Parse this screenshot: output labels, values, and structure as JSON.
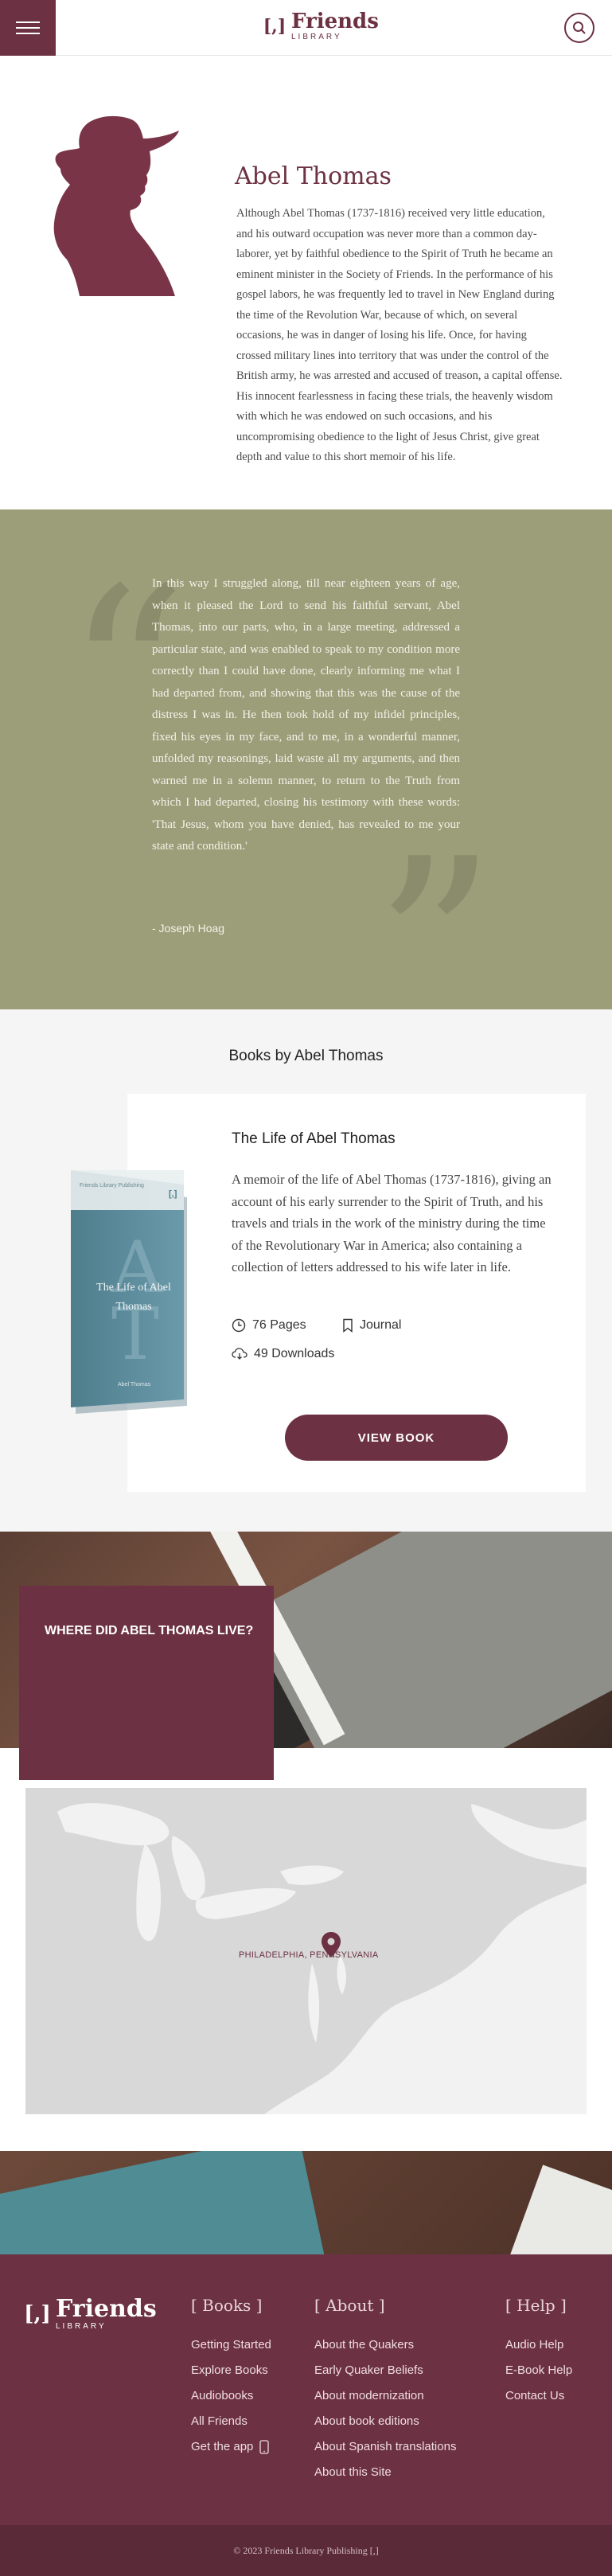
{
  "header": {
    "logo_mark": "[,]",
    "logo_name": "Friends",
    "logo_sub": "LIBRARY"
  },
  "author": {
    "name": "Abel Thomas",
    "bio": "Although Abel Thomas (1737-1816) received very little education, and his outward occupation was never more than a common day-laborer, yet by faithful obedience to the Spirit of Truth he became an eminent minister in the Society of Friends. In the performance of his gospel labors, he was frequently led to travel in New England during the time of the Revolution War, because of which, on several occasions, he was in danger of losing his life. Once, for having crossed military lines into territory that was under the control of the British army, he was arrested and accused of treason, a capital offense. His innocent fearlessness in facing these trials, the heavenly wisdom with which he was endowed on such occasions, and his uncompromising obedience to the light of Jesus Christ, give great depth and value to this short memoir of his life."
  },
  "quote": {
    "text": "In this way I struggled along, till near eighteen years of age, when it pleased the Lord to send his faithful servant, Abel Thomas, into our parts, who, in a large meeting, addressed a particular state, and was enabled to speak to my condition more correctly than I could have done, clearly informing me what I had departed from, and showing that this was the cause of the distress I was in. He then took hold of my infidel principles, fixed his eyes in my face, and to me, in a wonderful manner, unfolded my reasonings, laid waste all my arguments, and then warned me in a solemn manner, to return to the Truth from which I had departed, closing his testimony with these words: 'That Jesus, whom you have denied, has revealed to me your state and condition.'",
    "author": "- Joseph Hoag"
  },
  "books": {
    "section_title": "Books by Abel Thomas",
    "items": [
      {
        "title": "The Life of Abel Thomas",
        "description": "A memoir of the life of Abel Thomas (1737-1816), giving an account of his early surrender to the Spirit of Truth, and his travels and trials in the work of the ministry during the time of the Revolutionary War in America; also containing a collection of letters addressed to his wife later in life.",
        "pages": "76 Pages",
        "edition": "Journal",
        "downloads": "49 Downloads",
        "button": "VIEW BOOK",
        "cover_title": "The Life of Abel Thomas",
        "cover_letter": "A",
        "cover_letter2": "T",
        "cover_publisher": "Friends Library Publishing",
        "cover_author": "Abel Thomas",
        "cover_color": "#5e8d9c"
      }
    ]
  },
  "where": {
    "title": "WHERE DID ABEL THOMAS LIVE?",
    "map_label": "PHILADELPHIA, PENNSYLVANIA"
  },
  "footer": {
    "columns": [
      {
        "heading": "[ Books ]",
        "links": [
          "Getting Started",
          "Explore Books",
          "Audiobooks",
          "All Friends",
          "Get the app"
        ]
      },
      {
        "heading": "[ About ]",
        "links": [
          "About the Quakers",
          "Early Quaker Beliefs",
          "About modernization",
          "About book editions",
          "About Spanish translations",
          "About this Site"
        ]
      },
      {
        "heading": "[ Help ]",
        "links": [
          "Audio Help",
          "E-Book Help",
          "Contact Us"
        ]
      }
    ],
    "copyright": "© 2023 Friends Library Publishing [,]"
  },
  "colors": {
    "brand": "#6c3142",
    "quote_bg": "#9c9e7a"
  }
}
